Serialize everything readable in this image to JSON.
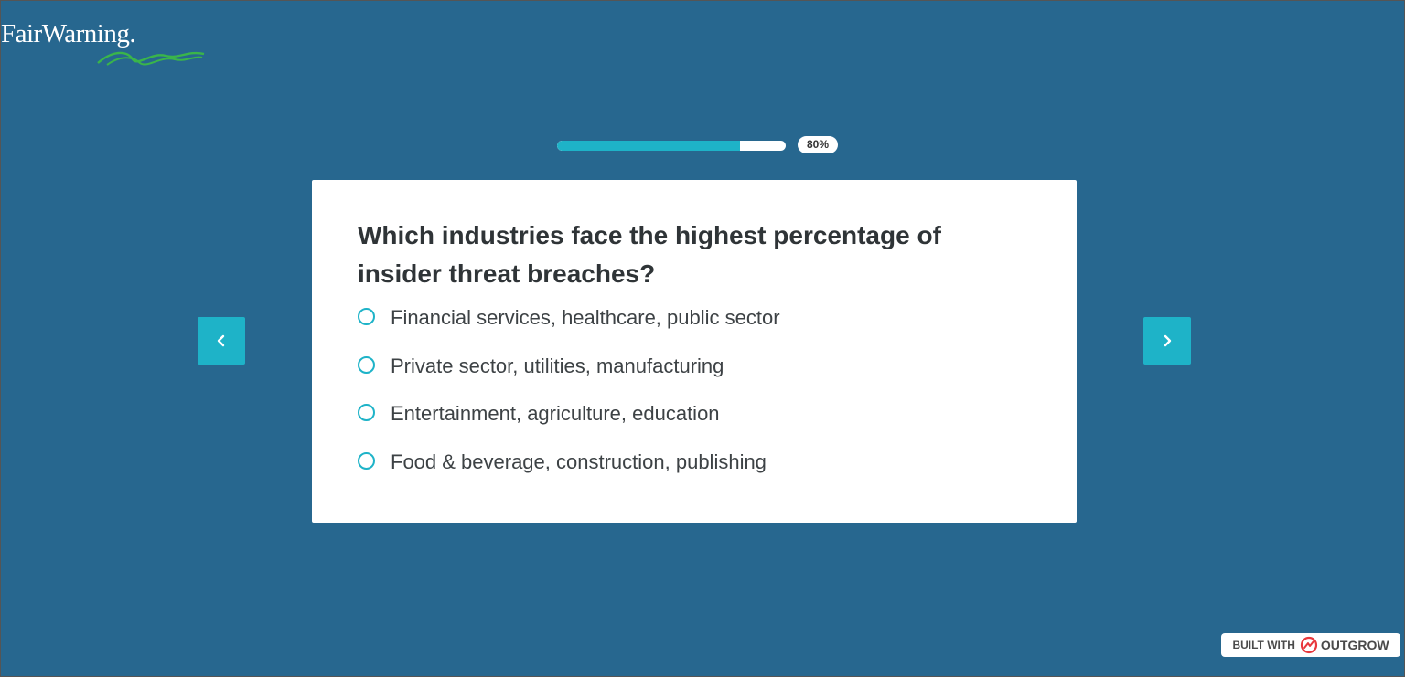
{
  "brand": {
    "logo_text": "FairWarning.",
    "swoosh_color": "#3ab54a"
  },
  "progress": {
    "percent": 80,
    "label": "80%"
  },
  "question": {
    "text": "Which industries face the highest percentage of insider threat breaches?",
    "options": [
      {
        "label": "Financial services, healthcare, public sector"
      },
      {
        "label": "Private sector, utilities, manufacturing"
      },
      {
        "label": "Entertainment, agriculture, education"
      },
      {
        "label": "Food & beverage, construction, publishing"
      }
    ]
  },
  "navigation": {
    "prev_icon": "chevron-left-icon",
    "next_icon": "chevron-right-icon"
  },
  "footer_badge": {
    "built_with": "BUILT WITH",
    "brand": "OUTGROW",
    "icon": "outgrow-logo-icon",
    "icon_color": "#e8383d"
  },
  "colors": {
    "background": "#27678f",
    "accent": "#1eb3c8",
    "card": "#ffffff"
  }
}
